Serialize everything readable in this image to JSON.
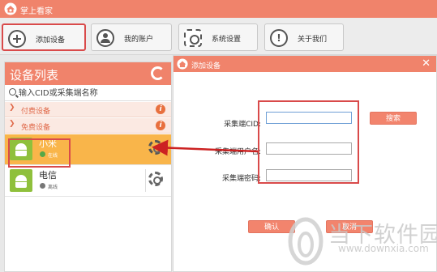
{
  "app": {
    "title": "掌上看家"
  },
  "toolbar": {
    "buttons": [
      {
        "label": "添加设备",
        "icon": "plus-circle-icon"
      },
      {
        "label": "我的账户",
        "icon": "user-icon"
      },
      {
        "label": "系统设置",
        "icon": "gear-icon"
      },
      {
        "label": "关于我们",
        "icon": "info-icon"
      }
    ]
  },
  "device_list": {
    "title": "设备列表",
    "search_placeholder": "输入CID或采集端名称",
    "groups": [
      {
        "label": "付费设备",
        "info": "i"
      },
      {
        "label": "免费设备",
        "info": "i"
      }
    ],
    "devices": [
      {
        "name": "小米",
        "status": "在线",
        "selected": true
      },
      {
        "name": "电信",
        "status": "离线",
        "selected": false
      }
    ]
  },
  "dialog": {
    "title": "添加设备",
    "close": "✕",
    "fields": [
      {
        "label": "采集端CID:",
        "value": ""
      },
      {
        "label": "采集端用户名:",
        "value": ""
      },
      {
        "label": "采集端密码:",
        "value": ""
      }
    ],
    "search_button": "搜索",
    "confirm_button": "确认",
    "cancel_button": "取消"
  },
  "colors": {
    "brand": "#f0836b",
    "selected_row": "#f9b54a",
    "annotation_red": "#d94a4a",
    "online": "#55a847"
  },
  "watermark": {
    "name": "当下软件园",
    "url": "www.downxia.com"
  }
}
